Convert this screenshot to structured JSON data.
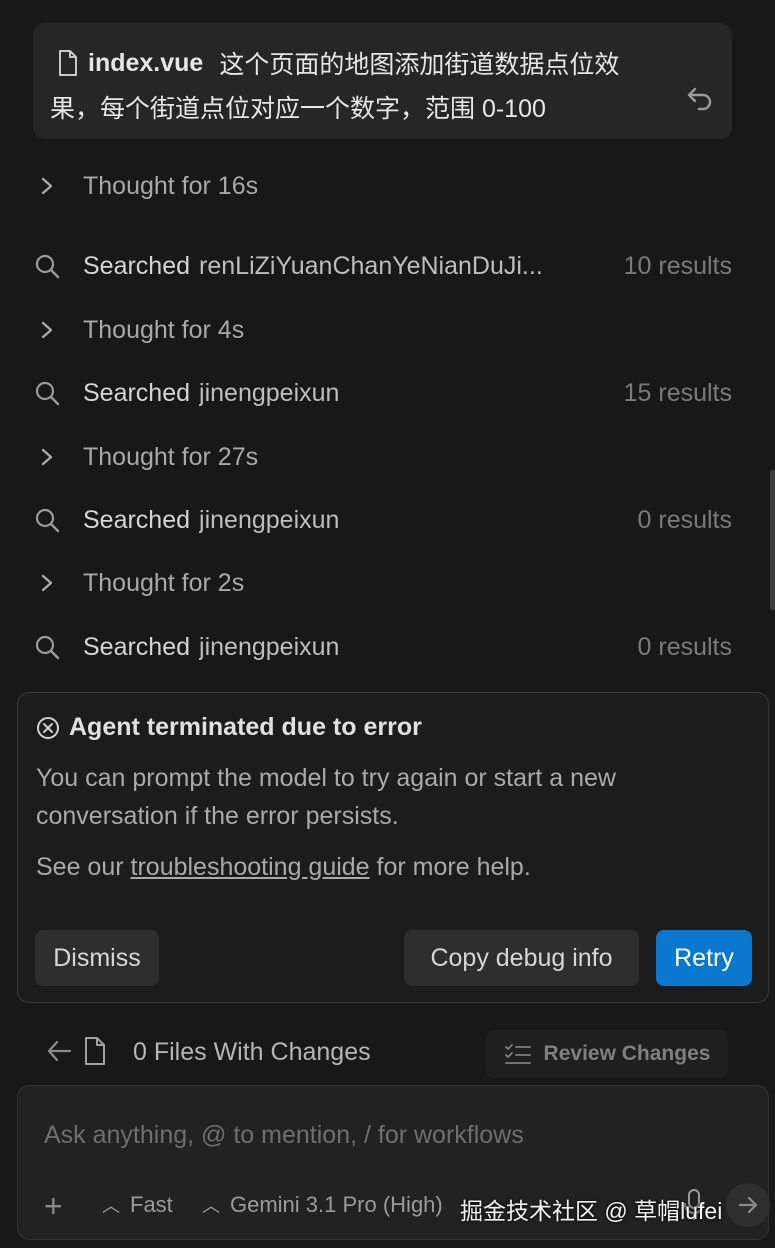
{
  "user_message": {
    "file_name": "index.vue",
    "line1": "这个页面的地图添加街道数据点位效",
    "line2": "果，每个街道点位对应一个数字，范围 0-100"
  },
  "activity": [
    {
      "type": "thought",
      "label": "Thought for 16s"
    },
    {
      "type": "search",
      "verb": "Searched",
      "query": "renLiZiYuanChanYeNianDuJi...",
      "results": "10 results"
    },
    {
      "type": "thought",
      "label": "Thought for 4s"
    },
    {
      "type": "search",
      "verb": "Searched",
      "query": "jinengpeixun",
      "results": "15 results"
    },
    {
      "type": "thought",
      "label": "Thought for 27s"
    },
    {
      "type": "search",
      "verb": "Searched",
      "query": "jinengpeixun",
      "results": "0 results"
    },
    {
      "type": "thought",
      "label": "Thought for 2s"
    },
    {
      "type": "search",
      "verb": "Searched",
      "query": "jinengpeixun",
      "results": "0 results"
    }
  ],
  "error": {
    "title": "Agent terminated due to error",
    "description": "You can prompt the model to try again or start a new conversation if the error persists.",
    "help_prefix": "See our",
    "help_link": "troubleshooting guide",
    "help_suffix": "for more help.",
    "dismiss": "Dismiss",
    "copy_debug": "Copy debug info",
    "retry": "Retry"
  },
  "changes": {
    "files_label": "0 Files With Changes",
    "review_label": "Review Changes"
  },
  "composer": {
    "placeholder": "Ask anything, @ to mention, / for workflows",
    "mode": "Fast",
    "model": "Gemini 3.1 Pro (High)"
  },
  "watermark": "掘金技术社区 @ 草帽lufei",
  "colors": {
    "background": "#181818",
    "retry_button": "#0b78d0",
    "card": "#262626"
  },
  "icons": [
    "file-icon",
    "undo-icon",
    "chevron-right-icon",
    "search-icon",
    "error-circle-icon",
    "arrow-left-icon",
    "checklist-icon",
    "plus-icon",
    "chevron-up-icon",
    "mic-icon",
    "send-icon"
  ]
}
